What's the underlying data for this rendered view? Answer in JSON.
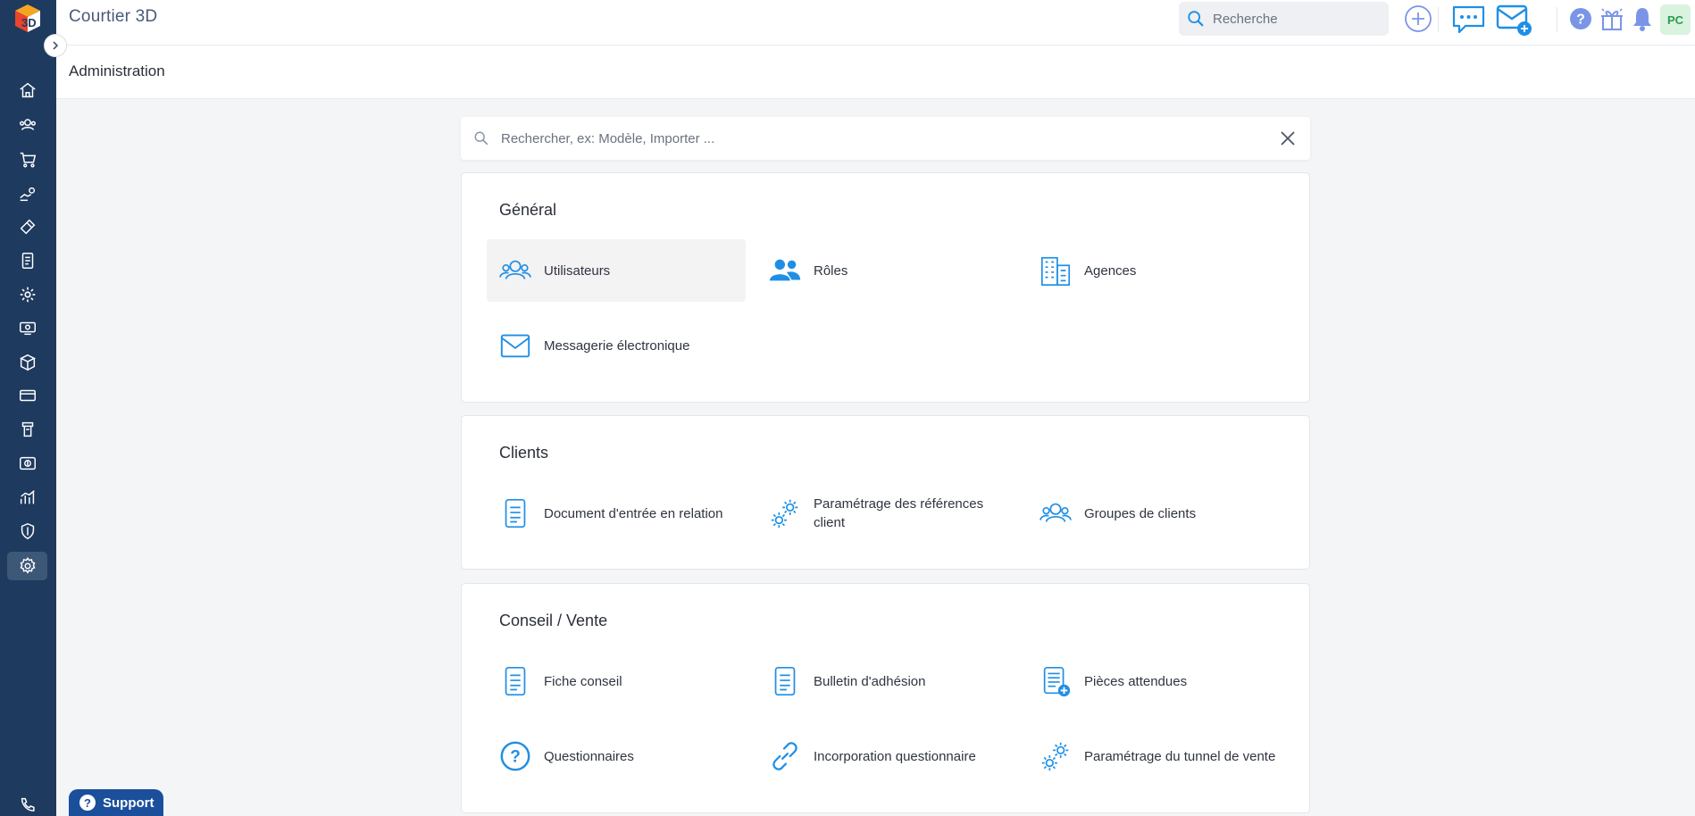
{
  "app": {
    "title": "Courtier 3D"
  },
  "topbar": {
    "search_placeholder": "Recherche",
    "avatar_initials": "PC"
  },
  "page": {
    "title": "Administration"
  },
  "admin_search": {
    "placeholder": "Rechercher, ex: Modèle, Importer ..."
  },
  "sections": [
    {
      "title": "Général",
      "items": [
        {
          "label": "Utilisateurs",
          "icon": "users-icon",
          "selected": true
        },
        {
          "label": "Rôles",
          "icon": "roles-icon"
        },
        {
          "label": "Agences",
          "icon": "building-icon"
        },
        {
          "label": "Messagerie électronique",
          "icon": "envelope-icon"
        }
      ]
    },
    {
      "title": "Clients",
      "items": [
        {
          "label": "Document d'entrée en relation",
          "icon": "document-icon"
        },
        {
          "label": "Paramétrage des références client",
          "icon": "gears-icon"
        },
        {
          "label": "Groupes de clients",
          "icon": "users-group-icon"
        }
      ]
    },
    {
      "title": "Conseil / Vente",
      "items": [
        {
          "label": "Fiche conseil",
          "icon": "document-icon"
        },
        {
          "label": "Bulletin d'adhésion",
          "icon": "document-icon"
        },
        {
          "label": "Pièces attendues",
          "icon": "document-add-icon"
        },
        {
          "label": "Questionnaires",
          "icon": "question-circle-icon"
        },
        {
          "label": "Incorporation questionnaire",
          "icon": "link-icon"
        },
        {
          "label": "Paramétrage du tunnel de vente",
          "icon": "gears-icon"
        }
      ]
    }
  ],
  "support": {
    "label": "Support"
  },
  "colors": {
    "sidebar": "#1e3a5f",
    "accent": "#1f8fe5",
    "support": "#1b4f9c"
  }
}
